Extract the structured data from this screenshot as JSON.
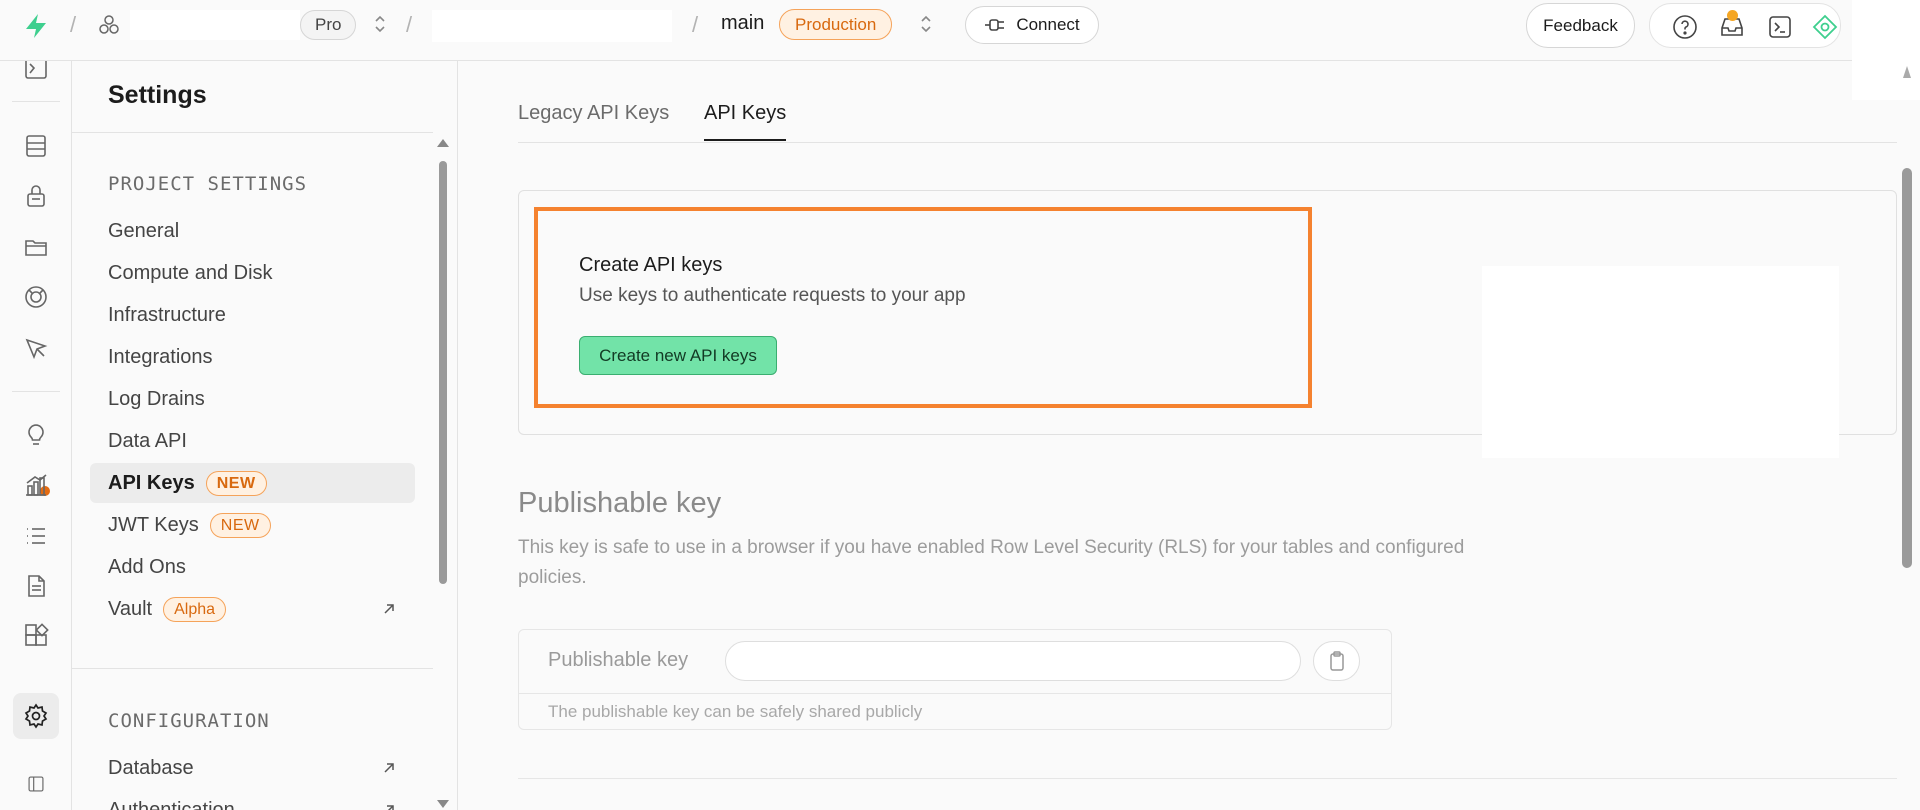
{
  "topbar": {
    "plan_badge": "Pro",
    "branch": "main",
    "env_badge": "Production",
    "connect_label": "Connect",
    "feedback_label": "Feedback",
    "icons": [
      "help-icon",
      "inbox-icon",
      "terminal-icon",
      "assistant-icon"
    ]
  },
  "rail": {
    "icons": [
      "table-editor-icon",
      "authentication-icon",
      "storage-icon",
      "realtime-icon",
      "edge-cursor-icon",
      "advisors-icon",
      "reports-icon",
      "logs-icon",
      "api-docs-icon",
      "integrations-icon",
      "settings-icon",
      "collapse-icon"
    ]
  },
  "sidebar": {
    "title": "Settings",
    "project_section": "PROJECT SETTINGS",
    "items": [
      {
        "label": "General"
      },
      {
        "label": "Compute and Disk"
      },
      {
        "label": "Infrastructure"
      },
      {
        "label": "Integrations"
      },
      {
        "label": "Log Drains"
      },
      {
        "label": "Data API"
      },
      {
        "label": "API Keys",
        "badge": "NEW"
      },
      {
        "label": "JWT Keys",
        "badge": "NEW"
      },
      {
        "label": "Add Ons"
      },
      {
        "label": "Vault",
        "badge": "Alpha"
      }
    ],
    "config_section": "CONFIGURATION",
    "config_items": [
      {
        "label": "Database"
      },
      {
        "label": "Authentication"
      }
    ]
  },
  "main": {
    "tabs": [
      {
        "label": "Legacy API Keys"
      },
      {
        "label": "API Keys"
      }
    ],
    "cta": {
      "title": "Create API keys",
      "subtitle": "Use keys to authenticate requests to your app",
      "button": "Create new API keys"
    },
    "publishable": {
      "title": "Publishable key",
      "description": "This key is safe to use in a browser if you have enabled Row Level Security (RLS) for your tables and configured policies.",
      "field_label": "Publishable key",
      "footer": "The publishable key can be safely shared publicly"
    }
  },
  "colors": {
    "brand_green": "#3ecf8e",
    "accent_orange": "#f5822f",
    "create_button": "#72e3a8"
  }
}
